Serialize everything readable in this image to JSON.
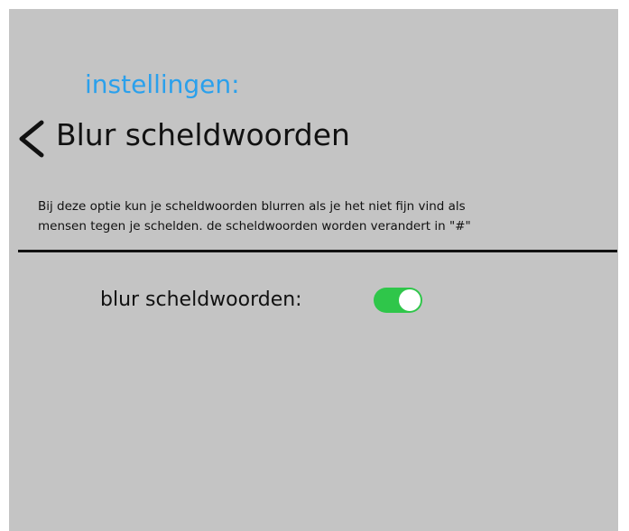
{
  "section_label": "instellingen:",
  "page_title": "Blur scheldwoorden",
  "back_icon": "chevron-left-icon",
  "description": {
    "line1": "Bij deze optie kun je scheldwoorden blurren als je het niet fijn vind als",
    "line2": "mensen tegen je schelden.  de scheldwoorden worden verandert in \"#\""
  },
  "settings": {
    "blur_label": "blur scheldwoorden:",
    "blur_enabled": true
  },
  "colors": {
    "background": "#c4c4c4",
    "accent": "#2aa0ec",
    "toggle_on": "#2fc64a",
    "toggle_off": "#9a9a9a",
    "text": "#111111"
  }
}
